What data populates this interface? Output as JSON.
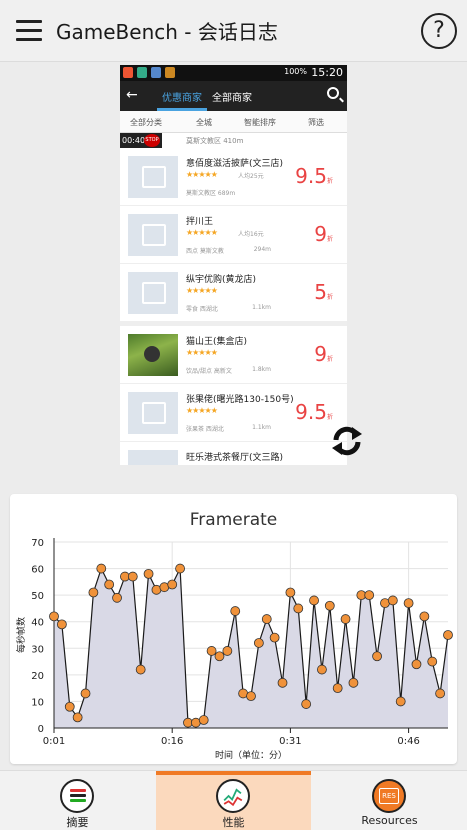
{
  "app": {
    "title": "GameBench - 会话日志",
    "help_glyph": "?",
    "menu_icon": "hamburger-menu-icon"
  },
  "screenshot": {
    "status_time": "15:20",
    "battery": "100%",
    "tabs": [
      "优惠商家",
      "全部商家"
    ],
    "filters": [
      "全部分类",
      "全城",
      "智能排序",
      "筛选"
    ],
    "partial_row": {
      "time": "00:40",
      "stop": "STOP",
      "meta": "莫斯文教区 410m"
    },
    "items": [
      {
        "name": "意佰度滋活披萨(文三店)",
        "stars": "★★★★★",
        "price": "人均25元",
        "meta": "莫斯文教区 689m",
        "discount": "9.5",
        "unit": "折",
        "dist": ""
      },
      {
        "name": "拌川王",
        "stars": "★★★★★",
        "price": "人均16元",
        "meta": "西点 莫斯文教",
        "discount": "9",
        "unit": "折",
        "dist": "294m"
      },
      {
        "name": "纵宇优购(黄龙店)",
        "stars": "★★★★★",
        "price": "",
        "meta": "零食 西湖北",
        "discount": "5",
        "unit": "折",
        "dist": "1.1km"
      },
      {
        "name": "猫山王(集盒店)",
        "stars": "★★★★★",
        "price": "",
        "meta": "饮品/甜点 高新文",
        "discount": "9",
        "unit": "折",
        "dist": "1.8km"
      },
      {
        "name": "张果佬(曙光路130-150号)",
        "stars": "★★★★★",
        "price": "",
        "meta": "张果茶 西湖北",
        "discount": "9.5",
        "unit": "折",
        "dist": "1.1km"
      }
    ],
    "last_item": "旺乐港式茶餐厅(文三路)"
  },
  "chart_data": {
    "type": "line",
    "title": "Framerate",
    "ylabel": "每秒帧数",
    "xlabel": "时间（单位：分）",
    "ylim": [
      0,
      70
    ],
    "yticks": [
      0,
      10,
      20,
      30,
      40,
      50,
      60,
      70
    ],
    "xticks": [
      "0:01",
      "0:16",
      "0:31",
      "0:46"
    ],
    "values": [
      42,
      39,
      8,
      4,
      13,
      51,
      60,
      54,
      49,
      57,
      57,
      22,
      58,
      52,
      53,
      54,
      60,
      2,
      2,
      3,
      29,
      27,
      29,
      44,
      13,
      12,
      32,
      41,
      34,
      17,
      51,
      45,
      9,
      48,
      22,
      46,
      15,
      41,
      17,
      50,
      50,
      27,
      47,
      48,
      10,
      47,
      24,
      42,
      25,
      13,
      35
    ],
    "colors": {
      "line": "#1a1a1a",
      "fill": "#d9d9e6",
      "point": "#f0923a"
    }
  },
  "bottom_nav": {
    "items": [
      {
        "label": "摘要",
        "icon": "summary-list-icon"
      },
      {
        "label": "性能",
        "icon": "performance-chart-icon"
      },
      {
        "label": "Resources",
        "icon": "resources-icon",
        "badge": "RES"
      }
    ],
    "active": "性能"
  }
}
